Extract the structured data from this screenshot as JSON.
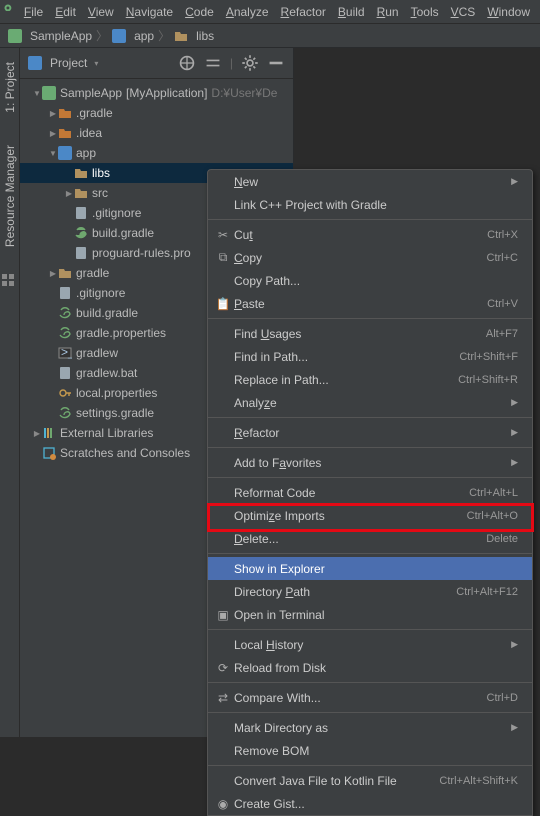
{
  "menubar": {
    "items": [
      "File",
      "Edit",
      "View",
      "Navigate",
      "Code",
      "Analyze",
      "Refactor",
      "Build",
      "Run",
      "Tools",
      "VCS",
      "Window"
    ]
  },
  "breadcrumb": {
    "items": [
      "SampleApp",
      "app",
      "libs"
    ]
  },
  "vtabs": {
    "project": "1: Project",
    "resmgr": "Resource Manager"
  },
  "panel": {
    "title": "Project"
  },
  "tree": {
    "root_label": "SampleApp",
    "root_qual": "[MyApplication]",
    "root_path": "D:¥User¥De",
    "n_gradle": ".gradle",
    "n_idea": ".idea",
    "n_app": "app",
    "n_libs": "libs",
    "n_src": "src",
    "n_gitignore": ".gitignore",
    "n_buildgradle": "build.gradle",
    "n_proguard": "proguard-rules.pro",
    "n_gradle2": "gradle",
    "n_gitignore2": ".gitignore",
    "n_buildgradle2": "build.gradle",
    "n_gradleprops": "gradle.properties",
    "n_gradlew": "gradlew",
    "n_gradlewbat": "gradlew.bat",
    "n_localprops": "local.properties",
    "n_settingsgradle": "settings.gradle",
    "n_extlib": "External Libraries",
    "n_scratch": "Scratches and Consoles"
  },
  "ctx": {
    "new": "New",
    "linkcpp": "Link C++ Project with Gradle",
    "cut": "Cut",
    "cut_sc": "Ctrl+X",
    "copy": "Copy",
    "copy_sc": "Ctrl+C",
    "copypath": "Copy Path...",
    "paste": "Paste",
    "paste_sc": "Ctrl+V",
    "findusages": "Find Usages",
    "findusages_sc": "Alt+F7",
    "findinpath": "Find in Path...",
    "findinpath_sc": "Ctrl+Shift+F",
    "replaceinpath": "Replace in Path...",
    "replaceinpath_sc": "Ctrl+Shift+R",
    "analyze": "Analyze",
    "refactor": "Refactor",
    "addfav": "Add to Favorites",
    "reformat": "Reformat Code",
    "reformat_sc": "Ctrl+Alt+L",
    "optimports": "Optimize Imports",
    "optimports_sc": "Ctrl+Alt+O",
    "delete": "Delete...",
    "delete_sc": "Delete",
    "showexp": "Show in Explorer",
    "dirpath": "Directory Path",
    "dirpath_sc": "Ctrl+Alt+F12",
    "openterm": "Open in Terminal",
    "localhist": "Local History",
    "reload": "Reload from Disk",
    "compare": "Compare With...",
    "compare_sc": "Ctrl+D",
    "markdir": "Mark Directory as",
    "removebom": "Remove BOM",
    "convkotlin": "Convert Java File to Kotlin File",
    "convkotlin_sc": "Ctrl+Alt+Shift+K",
    "gist": "Create Gist..."
  }
}
